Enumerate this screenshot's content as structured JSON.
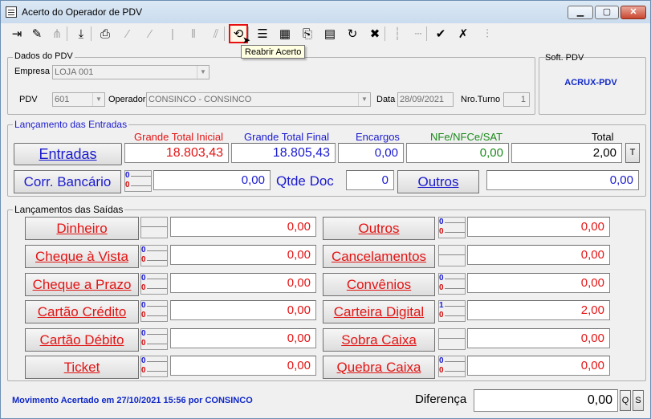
{
  "window": {
    "title": "Acerto do Operador de PDV",
    "min_label": "▁",
    "max_label": "▢",
    "close_label": "✕"
  },
  "toolbar": {
    "tooltip": "Reabrir Acerto",
    "buttons": [
      {
        "icon": "exit-icon",
        "glyph": "⇥",
        "enabled": true
      },
      {
        "icon": "eraser-icon",
        "glyph": "✎",
        "enabled": true
      },
      {
        "icon": "tree-icon",
        "glyph": "⋔",
        "enabled": false
      },
      {
        "icon": "download-icon",
        "glyph": "⤓",
        "enabled": true
      },
      {
        "icon": "save-icon",
        "glyph": "⎙",
        "enabled": true
      },
      {
        "icon": "pen-icon",
        "glyph": "⁄",
        "enabled": false
      },
      {
        "icon": "pen2-icon",
        "glyph": "⁄",
        "enabled": false
      },
      {
        "icon": "bar-icon",
        "glyph": "|",
        "enabled": false
      },
      {
        "icon": "double-bar-icon",
        "glyph": "‖",
        "enabled": false
      },
      {
        "icon": "double-slash-icon",
        "glyph": "⫽",
        "enabled": false
      },
      {
        "icon": "reopen-icon",
        "glyph": "⟲",
        "enabled": true,
        "highlighted": true
      },
      {
        "icon": "list-icon",
        "glyph": "☰",
        "enabled": true
      },
      {
        "icon": "grid-icon",
        "glyph": "▦",
        "enabled": true
      },
      {
        "icon": "preview-icon",
        "glyph": "⎘",
        "enabled": true
      },
      {
        "icon": "report-icon",
        "glyph": "▤",
        "enabled": true
      },
      {
        "icon": "refresh-icon",
        "glyph": "↻",
        "enabled": true
      },
      {
        "icon": "delete-icon",
        "glyph": "✖",
        "enabled": true
      },
      {
        "icon": "dotted-line-icon",
        "glyph": "┆",
        "enabled": false
      },
      {
        "icon": "dotted-box-icon",
        "glyph": "┄",
        "enabled": false
      },
      {
        "icon": "confirm-icon",
        "glyph": "✔",
        "enabled": true
      },
      {
        "icon": "cancel-icon",
        "glyph": "✗",
        "enabled": true
      },
      {
        "icon": "check-list-icon",
        "glyph": "⫶",
        "enabled": false
      }
    ]
  },
  "dados_pdv": {
    "legend": "Dados do PDV",
    "empresa_label": "Empresa",
    "empresa_value": "LOJA 001",
    "pdv_label": "PDV",
    "pdv_value": "601",
    "operador_label": "Operador",
    "operador_value": "CONSINCO - CONSINCO",
    "data_label": "Data",
    "data_value": "28/09/2021",
    "turno_label": "Nro.Turno",
    "turno_value": "1"
  },
  "soft_pdv": {
    "legend": "Soft. PDV",
    "name": "ACRUX-PDV"
  },
  "entradas": {
    "legend": "Lançamento das Entradas",
    "headers": {
      "grande_total_inicial": "Grande Total Inicial",
      "grande_total_final": "Grande Total Final",
      "encargos": "Encargos",
      "nfe": "NFe/NFCe/SAT",
      "total": "Total"
    },
    "entradas_button": "Entradas",
    "grande_total_inicial": "18.803,43",
    "grande_total_final": "18.805,43",
    "encargos": "0,00",
    "nfe": "0,00",
    "total": "2,00",
    "t_button": "T",
    "corr_bancario_button": "Corr. Bancário",
    "corr_bancario_top": "0",
    "corr_bancario_bottom": "0",
    "corr_bancario_value": "0,00",
    "qtde_doc_label": "Qtde Doc",
    "qtde_doc_value": "0",
    "outros_button": "Outros",
    "outros_value": "0,00"
  },
  "saidas": {
    "legend": "Lançamentos das Saídas",
    "left": [
      {
        "label": "Dinheiro",
        "counts": null,
        "value": "0,00"
      },
      {
        "label": "Cheque à Vista",
        "counts": [
          "0",
          "0"
        ],
        "value": "0,00"
      },
      {
        "label": "Cheque a Prazo",
        "counts": [
          "0",
          "0"
        ],
        "value": "0,00"
      },
      {
        "label": "Cartão Crédito",
        "counts": [
          "0",
          "0"
        ],
        "value": "0,00"
      },
      {
        "label": "Cartão Débito",
        "counts": [
          "0",
          "0"
        ],
        "value": "0,00"
      },
      {
        "label": "Ticket",
        "counts": [
          "0",
          "0"
        ],
        "value": "0,00"
      }
    ],
    "right": [
      {
        "label": "Outros",
        "counts": [
          "0",
          "0"
        ],
        "value": "0,00"
      },
      {
        "label": "Cancelamentos",
        "counts": null,
        "value": "0,00"
      },
      {
        "label": "Convênios",
        "counts": [
          "0",
          "0"
        ],
        "value": "0,00"
      },
      {
        "label": "Carteira Digital",
        "counts": [
          "1",
          "0"
        ],
        "value": "2,00"
      },
      {
        "label": "Sobra Caixa",
        "counts": null,
        "value": "0,00"
      },
      {
        "label": "Quebra Caixa",
        "counts": [
          "0",
          "0"
        ],
        "value": "0,00"
      }
    ]
  },
  "footer": {
    "status": "Movimento Acertado em 27/10/2021 15:56 por CONSINCO",
    "diferenca_label": "Diferença",
    "diferenca_value": "0,00",
    "q_button": "Q",
    "s_button": "S"
  },
  "colors": {
    "accent_blue": "#1a1ad0",
    "accent_red": "#e31414",
    "accent_green": "#1a8a1a",
    "status_blue": "#1028c8",
    "highlight_border": "#e81010"
  }
}
